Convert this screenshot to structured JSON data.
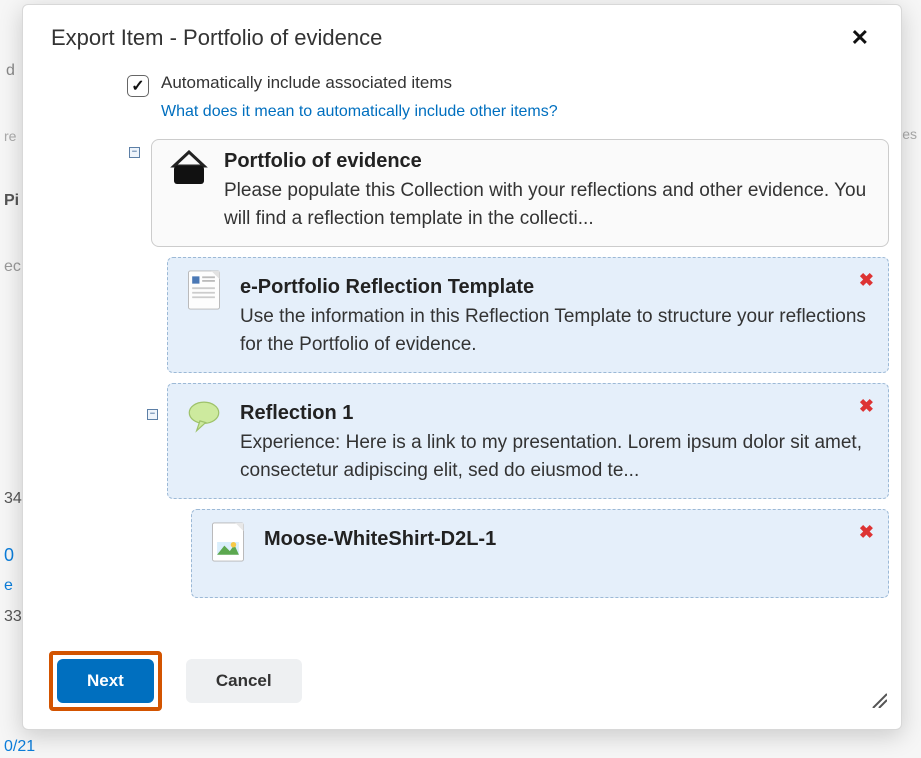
{
  "dialog": {
    "title": "Export Item - Portfolio of evidence",
    "auto_include_label": "Automatically include associated items",
    "help_link": "What does it mean to automatically include other items?",
    "auto_include_checked": true
  },
  "tree": {
    "root": {
      "title": "Portfolio of evidence",
      "description": "Please populate this Collection with your reflections and other evidence. You will find a reflection template in the collecti..."
    },
    "children": [
      {
        "icon": "document",
        "title": "e-Portfolio Reflection Template",
        "description": "Use the information in this Reflection Template to structure your reflections for the Portfolio of evidence."
      },
      {
        "icon": "reflection-cloud",
        "title": "Reflection 1",
        "description": "Experience: Here is a link to my presentation. Lorem ipsum dolor sit amet, consectetur adipiscing elit, sed do eiusmod te...",
        "children": [
          {
            "icon": "image",
            "title": "Moose-WhiteShirt-D2L-1"
          }
        ]
      }
    ]
  },
  "footer": {
    "primary": "Next",
    "secondary": "Cancel"
  },
  "bg": {
    "d": "d",
    "re": "re",
    "pi": "Pi",
    "ec": "ec",
    "es": "es",
    "n34": "34",
    "n0": "0",
    "e": "e",
    "n33": "33",
    "n021": "0/21"
  }
}
